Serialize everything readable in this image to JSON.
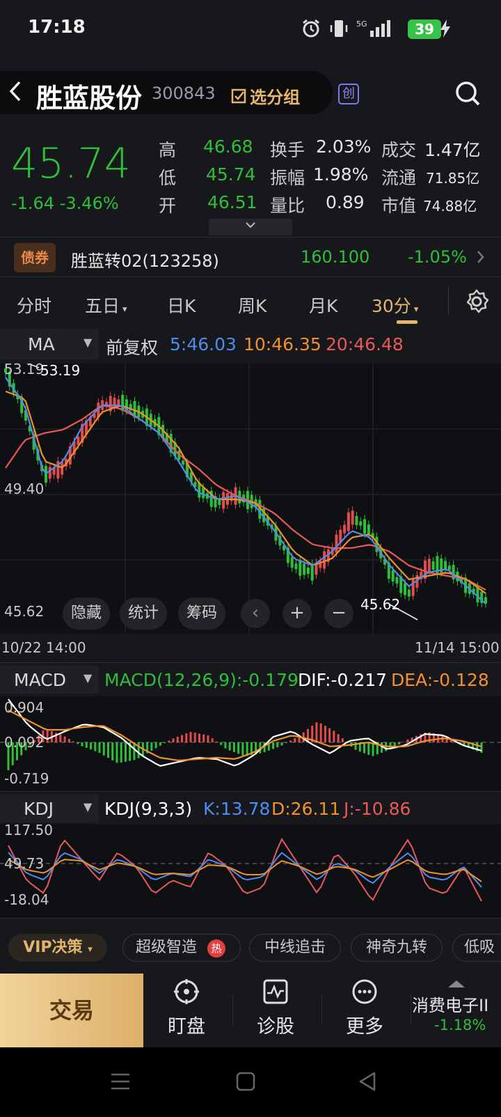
{
  "status_bar": {
    "time": "17:18",
    "battery": "39",
    "network": "5G"
  },
  "header": {
    "back_icon": "chevron-left-icon",
    "name": "胜蓝股份",
    "code": "300843",
    "group_label": "选分组",
    "board_badge": "创"
  },
  "quote": {
    "price": "45.74",
    "change": "-1.64",
    "change_pct": "-3.46%",
    "high_label": "高",
    "high": "46.68",
    "low_label": "低",
    "low": "45.74",
    "open_label": "开",
    "open": "46.51",
    "turnover_label": "换手",
    "turnover": "2.03%",
    "amplitude_label": "振幅",
    "amplitude": "1.98%",
    "vol_ratio_label": "量比",
    "vol_ratio": "0.89",
    "amount_label": "成交",
    "amount": "1.47亿",
    "float_label": "流通",
    "float_cap": "71.85亿",
    "mcap_label": "市值",
    "mcap": "74.88亿",
    "expand_icon": "chevron-down-icon"
  },
  "bond": {
    "badge": "债券",
    "name": "胜蓝转02(123258)",
    "price": "160.100",
    "change": "-1.05%"
  },
  "tabs": [
    {
      "label": "分时"
    },
    {
      "label": "五日"
    },
    {
      "label": "日K"
    },
    {
      "label": "周K"
    },
    {
      "label": "月K"
    },
    {
      "label": "30分"
    }
  ],
  "active_tab": "30分",
  "ma": {
    "selector": "MA",
    "adjust": "前复权",
    "ma5": "5:46.03",
    "ma10": "10:46.35",
    "ma20": "20:46.48"
  },
  "main_chart": {
    "axis_top": "53.19",
    "axis_mid": "49.40",
    "axis_bottom": "45.62",
    "high_marker": "53.19",
    "low_marker": "45.62",
    "date_start": "10/22 14:00",
    "date_end": "11/14 15:00",
    "buttons": {
      "hide": "隐藏",
      "stats": "统计",
      "chips": "筹码"
    }
  },
  "macd": {
    "selector": "MACD",
    "title": "MACD(12,26,9):-0.179",
    "dif": "DIF:-0.217",
    "dea": "DEA:-0.128",
    "axis_top": "0.904",
    "axis_mid": "0.092",
    "axis_bottom": "-0.719"
  },
  "kdj": {
    "selector": "KDJ",
    "title": "KDJ(9,3,3)",
    "k": "K:13.78",
    "d": "D:26.11",
    "j": "J:-10.86",
    "axis_top": "117.50",
    "axis_mid": "49.73",
    "axis_bottom": "-18.04"
  },
  "tools": {
    "vip": "VIP决策",
    "t1": "超级智造",
    "hot_badge": "热",
    "t2": "中线追击",
    "t3": "神奇九转",
    "t4": "低吸"
  },
  "bottom_nav": {
    "trade": "交易",
    "watch": "盯盘",
    "diagnose": "诊股",
    "more": "更多",
    "sector_name": "消费电子II",
    "sector_change": "-1.18%"
  },
  "colors": {
    "up": "#e24c4c",
    "down": "#2fbf3a",
    "accent": "#e8b56c",
    "ma5": "#4e8cf0",
    "ma10": "#f0912a",
    "ma20": "#e85a5a"
  }
}
